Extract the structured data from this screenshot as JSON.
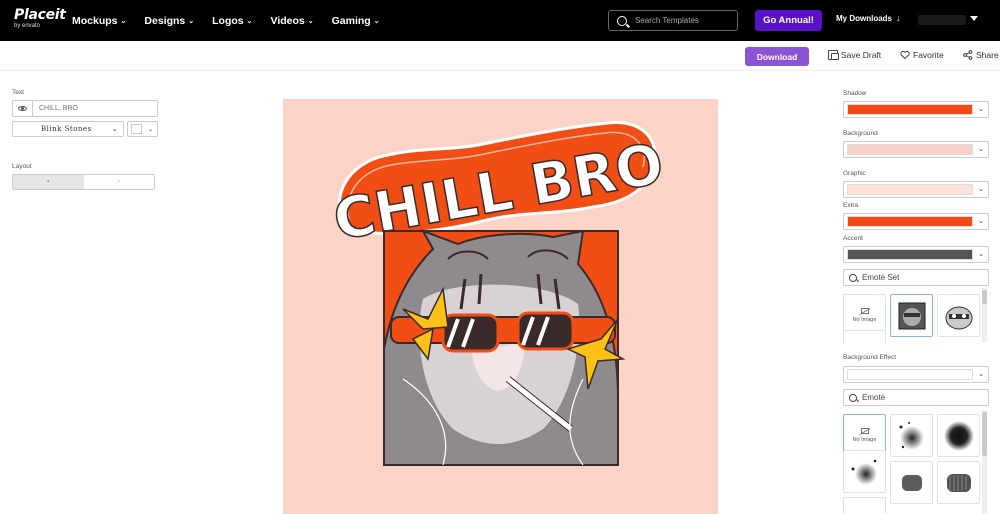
{
  "nav": {
    "brand": "Placeit",
    "brand_sub": "by envato",
    "links": [
      {
        "label": "Mockups"
      },
      {
        "label": "Designs"
      },
      {
        "label": "Logos"
      },
      {
        "label": "Videos"
      },
      {
        "label": "Gaming"
      }
    ],
    "search_placeholder": "Search Templates",
    "go_annual": "Go Annual!",
    "my_downloads": "My Downloads",
    "colors": {
      "bg": "#000000",
      "go_annual": "#5a12c8"
    }
  },
  "actions": {
    "download": "Download",
    "save_draft": "Save Draft",
    "favorite": "Favorite",
    "share": "Share",
    "download_color": "#8b54d4"
  },
  "left_panel": {
    "text_label": "Text",
    "text_placeholder": "CHILL, BRO",
    "font_name": "Blink Stones",
    "layout_label": "Layout"
  },
  "canvas": {
    "background": "#fbd3c7",
    "headline": "CHILL BRO",
    "accent": "#f04e15"
  },
  "right_panel": {
    "colors": [
      {
        "label": "Shadow",
        "value": "#f24a14"
      },
      {
        "label": "Background",
        "value": "#f8d0c8"
      },
      {
        "label": "Graphic",
        "value": "#fde2da"
      },
      {
        "label": "Extra",
        "value": "#f24a14"
      },
      {
        "label": "Accent",
        "value": "#555555"
      }
    ],
    "emote_set_placeholder": "Emote Set",
    "no_image": "No Image",
    "background_effect_label": "Background Effect",
    "emote_placeholder": "Emote"
  }
}
